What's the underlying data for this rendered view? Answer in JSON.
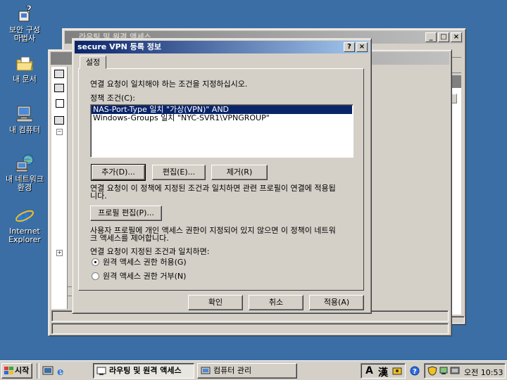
{
  "desktop": {
    "icons": [
      {
        "label_line1": "보안 구성",
        "label_line2": "마법사"
      },
      {
        "label_line1": "내 문서",
        "label_line2": ""
      },
      {
        "label_line1": "내 컴퓨터",
        "label_line2": ""
      },
      {
        "label_line1": "내 네트워크",
        "label_line2": "환경"
      },
      {
        "label_line1": "Internet",
        "label_line2": "Explorer"
      }
    ]
  },
  "back_window": {
    "title": "라우팅 및 원격 액세스"
  },
  "dialog": {
    "title": "secure VPN 등록 정보",
    "help_btn": "?",
    "close_btn": "×",
    "tab_label": "설정",
    "intro_text": "연결 요청이 일치해야 하는 조건을 지정하십시오.",
    "conditions_label": "정책 조건(C):",
    "conditions": [
      "NAS-Port-Type 일치 \"가상(VPN)\" AND",
      "Windows-Groups 일치 \"NYC-SVR1\\VPNGROUP\""
    ],
    "add_btn": "추가(D)...",
    "edit_btn": "편집(E)...",
    "remove_btn": "제거(R)",
    "profile_text_1": "연결 요청이 이 정책에 지정된 조건과 일치하면 관련 프로필이 연결에 적용됩",
    "profile_text_2": "니다.",
    "profile_btn": "프로필 편집(P)...",
    "access_text_1": "사용자 프로필에 개인 액세스 권한이 지정되어 있지 않으면 이 정책이 네트워",
    "access_text_2": "크 액세스를 제어합니다.",
    "match_label": "연결 요청이 지정된 조건과 일치하면:",
    "radio_grant": "원격 액세스 권한 허용(G)",
    "radio_deny": "원격 액세스 권한 거부(N)",
    "ok_btn": "확인",
    "cancel_btn": "취소",
    "apply_btn": "적용(A)"
  },
  "taskbar": {
    "start": "시작",
    "task_routing": "라우팅 및 원격 액세스",
    "task_computer": "컴퓨터 관리",
    "ime_a": "A",
    "ime_han": "漢",
    "time": "오전 10:53"
  },
  "colors": {
    "desktop": "#3a6ea5",
    "title_active": "#0a246a",
    "face": "#d4d0c8",
    "selection": "#0a246a"
  }
}
